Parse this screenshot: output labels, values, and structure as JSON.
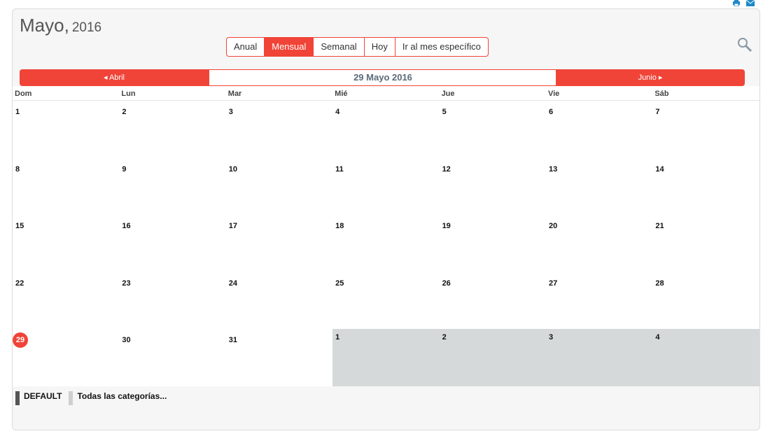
{
  "header": {
    "month": "Mayo,",
    "year": "2016"
  },
  "views": [
    "Anual",
    "Mensual",
    "Semanal",
    "Hoy",
    "Ir al mes específico"
  ],
  "active_view": "Mensual",
  "nav": {
    "prev": "◂ Abril",
    "current": "29 Mayo 2016",
    "next": "Junio ▸"
  },
  "day_headers": [
    "Dom",
    "Lun",
    "Mar",
    "Mié",
    "Jue",
    "Vie",
    "Sáb"
  ],
  "weeks": [
    [
      "1",
      "2",
      "3",
      "4",
      "5",
      "6",
      "7"
    ],
    [
      "8",
      "9",
      "10",
      "11",
      "12",
      "13",
      "14"
    ],
    [
      "15",
      "16",
      "17",
      "18",
      "19",
      "20",
      "21"
    ],
    [
      "22",
      "23",
      "24",
      "25",
      "26",
      "27",
      "28"
    ],
    [
      "29",
      "30",
      "31",
      "1",
      "2",
      "3",
      "4"
    ]
  ],
  "today": "29",
  "legend": [
    {
      "label": "DEFAULT",
      "color": "#555555"
    },
    {
      "label": "Todas las categorías...",
      "color": "#cfcfcf"
    }
  ],
  "colors": {
    "accent": "#f04438",
    "icon": "#1e88c8"
  }
}
